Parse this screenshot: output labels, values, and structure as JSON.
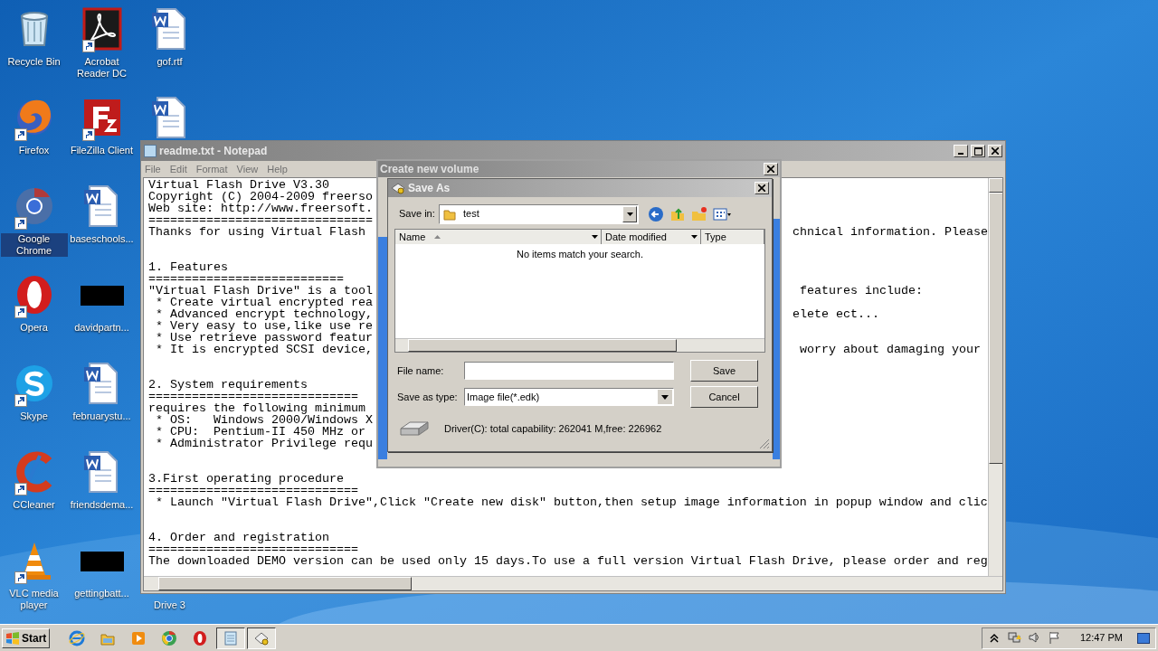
{
  "desktop": {
    "icons": [
      {
        "label": "Recycle Bin",
        "kind": "recycle",
        "shortcut": false,
        "selected": false
      },
      {
        "label": "Acrobat Reader DC",
        "kind": "acrobat",
        "shortcut": true,
        "selected": false
      },
      {
        "label": "gof.rtf",
        "kind": "word",
        "shortcut": false,
        "selected": false
      },
      {
        "label": "Firefox",
        "kind": "firefox",
        "shortcut": true,
        "selected": false
      },
      {
        "label": "FileZilla Client",
        "kind": "filezilla",
        "shortcut": true,
        "selected": false
      },
      {
        "kind": "word",
        "shortcut": false
      },
      {
        "label": "Google Chrome",
        "kind": "chrome",
        "shortcut": true,
        "selected": true
      },
      {
        "label": "baseschools...",
        "kind": "word",
        "shortcut": false,
        "selected": false
      },
      {
        "kind": "empty"
      },
      {
        "label": "Opera",
        "kind": "opera",
        "shortcut": true,
        "selected": false
      },
      {
        "label": "davidpartn...",
        "kind": "black",
        "shortcut": false,
        "selected": false
      },
      {
        "kind": "empty"
      },
      {
        "label": "Skype",
        "kind": "skype",
        "shortcut": true,
        "selected": false
      },
      {
        "label": "februarystu...",
        "kind": "word",
        "shortcut": false,
        "selected": false
      },
      {
        "kind": "empty"
      },
      {
        "label": "CCleaner",
        "kind": "ccleaner",
        "shortcut": true,
        "selected": false
      },
      {
        "label": "friendsdema...",
        "kind": "word",
        "shortcut": false,
        "selected": false
      },
      {
        "kind": "empty"
      },
      {
        "label": "VLC media player",
        "kind": "vlc",
        "shortcut": true,
        "selected": false
      },
      {
        "label": "gettingbatt...",
        "kind": "black",
        "shortcut": false,
        "selected": false
      },
      {
        "label": "Drive 3",
        "kind": "covered",
        "shortcut": false,
        "selected": false
      }
    ]
  },
  "notepad": {
    "title": "readme.txt - Notepad",
    "menu": [
      "File",
      "Edit",
      "Format",
      "View",
      "Help"
    ],
    "lines": [
      {
        "kind": "text",
        "left": "Virtual Flash Drive V3.30"
      },
      {
        "kind": "text",
        "left": "Copyright (C) 2004-2009 freerso"
      },
      {
        "kind": "text",
        "left": "Web site: http://www.freersoft."
      },
      {
        "kind": "text",
        "left": "==============================="
      },
      {
        "kind": "text",
        "left": "Thanks for using Virtual Flash",
        "right": "chnical information. Please"
      },
      {
        "kind": "blank"
      },
      {
        "kind": "blank"
      },
      {
        "kind": "text",
        "left": "1. Features"
      },
      {
        "kind": "text",
        "left": "==========================="
      },
      {
        "kind": "text",
        "left": "\"Virtual Flash Drive\" is a tool",
        "right": " features include:"
      },
      {
        "kind": "text",
        "left": " * Create virtual encrypted rea"
      },
      {
        "kind": "text",
        "left": " * Advanced encrypt technology,",
        "right": "elete ect..."
      },
      {
        "kind": "text",
        "left": " * Very easy to use,like use re"
      },
      {
        "kind": "text",
        "left": " * Use retrieve password featur"
      },
      {
        "kind": "text",
        "left": " * It is encrypted SCSI device,",
        "right": " worry about damaging your"
      },
      {
        "kind": "blank"
      },
      {
        "kind": "blank"
      },
      {
        "kind": "text",
        "left": "2. System requirements"
      },
      {
        "kind": "text",
        "left": "============================="
      },
      {
        "kind": "text",
        "left": "requires the following minimum"
      },
      {
        "kind": "text",
        "left": " * OS:   Windows 2000/Windows X"
      },
      {
        "kind": "text",
        "left": " * CPU:  Pentium-II 450 MHz or"
      },
      {
        "kind": "text",
        "left": " * Administrator Privilege requ"
      },
      {
        "kind": "blank"
      },
      {
        "kind": "blank"
      },
      {
        "kind": "text",
        "left": "3.First operating procedure"
      },
      {
        "kind": "text",
        "left": "============================="
      },
      {
        "kind": "text",
        "left": " * Launch \"Virtual Flash Drive\",Click \"Create new disk\" button,then setup image information in popup window and clic"
      },
      {
        "kind": "blank"
      },
      {
        "kind": "blank"
      },
      {
        "kind": "text",
        "left": "4. Order and registration"
      },
      {
        "kind": "text",
        "left": "============================="
      },
      {
        "kind": "text",
        "left": "The downloaded DEMO version can be used only 15 days.To use a full version Virtual Flash Drive, please order and reg"
      }
    ]
  },
  "create_volume": {
    "title": "Create new volume",
    "save_as": {
      "title": "Save As",
      "save_in_label": "Save in:",
      "save_in_value": "test",
      "columns": [
        "Name",
        "Date modified",
        "Type"
      ],
      "empty_message": "No items match your search.",
      "file_name_label": "File name:",
      "save_type_label": "Save as type:",
      "save_type_value": "Image file(*.edk)",
      "buttons": [
        "Save",
        "Cancel"
      ],
      "drive_info": "Driver(C): total capability: 262041 M,free: 226962"
    }
  },
  "taskbar": {
    "start": "Start",
    "apps": [
      {
        "kind": "ie",
        "selected": false
      },
      {
        "kind": "explorer",
        "selected": false
      },
      {
        "kind": "media",
        "selected": false
      },
      {
        "kind": "chrome",
        "selected": false
      },
      {
        "kind": "opera",
        "selected": false
      },
      {
        "kind": "notepad",
        "selected": true
      },
      {
        "kind": "drive",
        "selected": true
      }
    ],
    "clock": "12:47 PM"
  }
}
